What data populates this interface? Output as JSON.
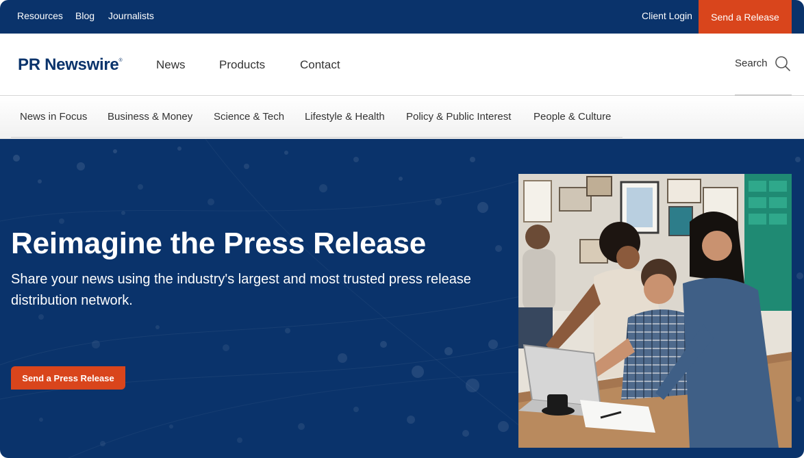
{
  "topbar": {
    "links": [
      "Resources",
      "Blog",
      "Journalists"
    ],
    "client_login": "Client Login",
    "send_release": "Send a Release"
  },
  "header": {
    "logo": "PR Newswire",
    "logo_mark": "®",
    "nav": [
      "News",
      "Products",
      "Contact"
    ],
    "search_label": "Search"
  },
  "categories": [
    "News in Focus",
    "Business & Money",
    "Science & Tech",
    "Lifestyle & Health",
    "Policy & Public Interest",
    "People & Culture"
  ],
  "hero": {
    "title": "Reimagine the Press Release",
    "subtitle": "Share your news using the industry's largest and most trusted press release distribution network.",
    "cta": "Send a Press Release"
  },
  "colors": {
    "navy": "#0a336b",
    "accent": "#d9451c"
  }
}
